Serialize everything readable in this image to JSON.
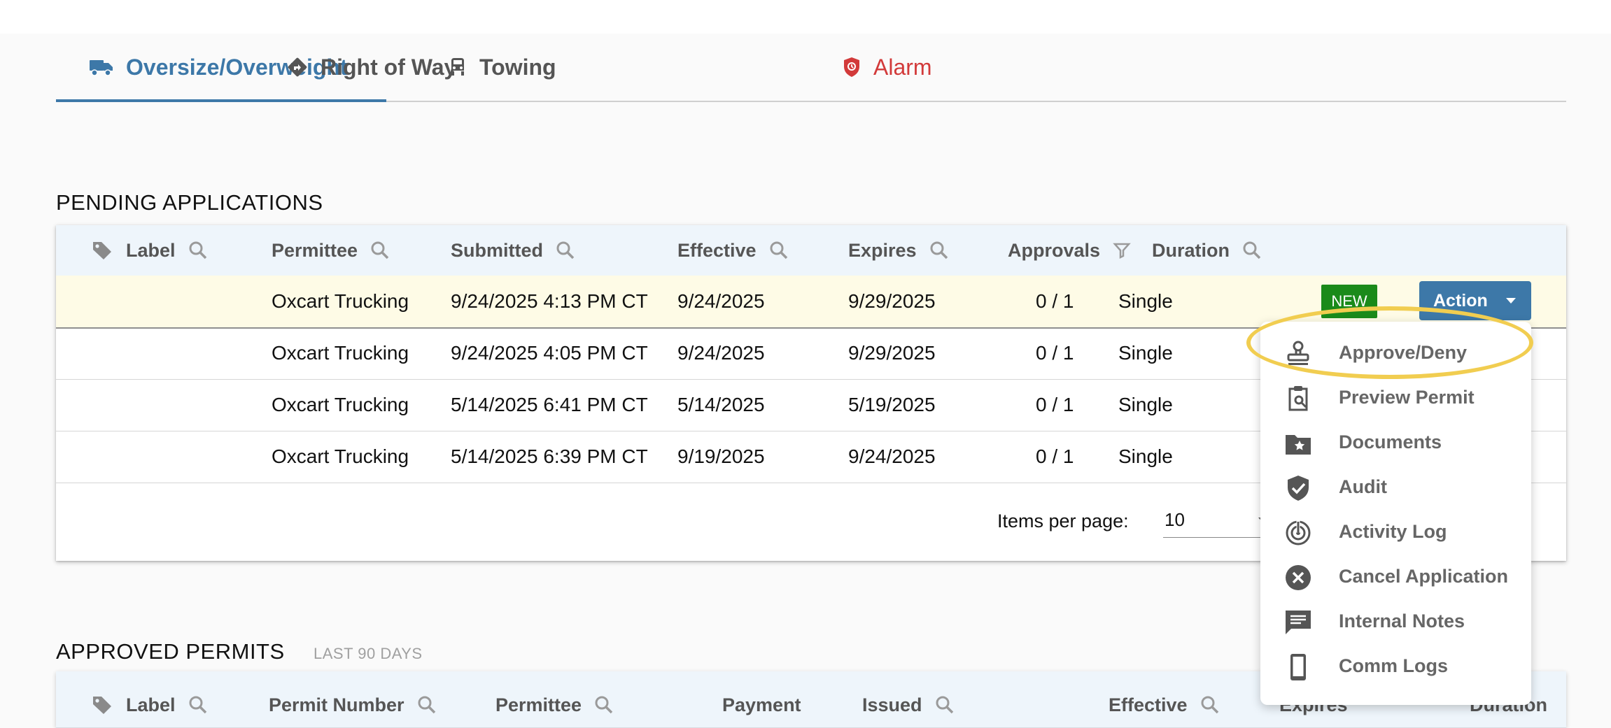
{
  "tabs": [
    {
      "label": "Oversize/Overweight",
      "icon": "truck-icon"
    },
    {
      "label": "Right of Way",
      "icon": "directions-icon"
    },
    {
      "label": "Towing",
      "icon": "car-icon"
    },
    {
      "label": "Alarm",
      "icon": "shield-alarm-icon"
    }
  ],
  "pending": {
    "title": "PENDING APPLICATIONS",
    "columns": {
      "label": "Label",
      "permittee": "Permittee",
      "submitted": "Submitted",
      "effective": "Effective",
      "expires": "Expires",
      "approvals": "Approvals",
      "duration": "Duration"
    },
    "rows": [
      {
        "permittee": "Oxcart Trucking",
        "submitted": "9/24/2025 4:13 PM CT",
        "effective": "9/24/2025",
        "expires": "9/29/2025",
        "approvals": "0 / 1",
        "duration": "Single"
      },
      {
        "permittee": "Oxcart Trucking",
        "submitted": "9/24/2025 4:05 PM CT",
        "effective": "9/24/2025",
        "expires": "9/29/2025",
        "approvals": "0 / 1",
        "duration": "Single"
      },
      {
        "permittee": "Oxcart Trucking",
        "submitted": "5/14/2025 6:41 PM CT",
        "effective": "5/14/2025",
        "expires": "5/19/2025",
        "approvals": "0 / 1",
        "duration": "Single"
      },
      {
        "permittee": "Oxcart Trucking",
        "submitted": "5/14/2025 6:39 PM CT",
        "effective": "9/19/2025",
        "expires": "9/24/2025",
        "approvals": "0 / 1",
        "duration": "Single"
      }
    ],
    "badge_new": "NEW",
    "action_label": "Action",
    "pager": {
      "label": "Items per page:",
      "value": "10"
    }
  },
  "approved": {
    "title": "APPROVED PERMITS",
    "subtitle": "LAST 90 DAYS",
    "columns": {
      "label": "Label",
      "permit_number": "Permit Number",
      "permittee": "Permittee",
      "payment": "Payment",
      "issued": "Issued",
      "effective": "Effective",
      "expires": "Expires",
      "duration": "Duration"
    }
  },
  "action_menu": {
    "items": [
      {
        "label": "Approve/Deny",
        "icon": "stamp-icon"
      },
      {
        "label": "Preview Permit",
        "icon": "clipboard-search-icon"
      },
      {
        "label": "Documents",
        "icon": "folder-star-icon"
      },
      {
        "label": "Audit",
        "icon": "shield-check-icon"
      },
      {
        "label": "Activity Log",
        "icon": "radar-icon"
      },
      {
        "label": "Cancel Application",
        "icon": "cancel-circle-icon"
      },
      {
        "label": "Internal Notes",
        "icon": "message-text-icon"
      },
      {
        "label": "Comm Logs",
        "icon": "cellphone-icon"
      }
    ]
  },
  "colors": {
    "accent": "#3d78a8",
    "alarm": "#d23a3a",
    "new_badge": "#1a8a1a",
    "row_highlight": "#fefbe6",
    "annotation_ring": "#f1cd50"
  }
}
